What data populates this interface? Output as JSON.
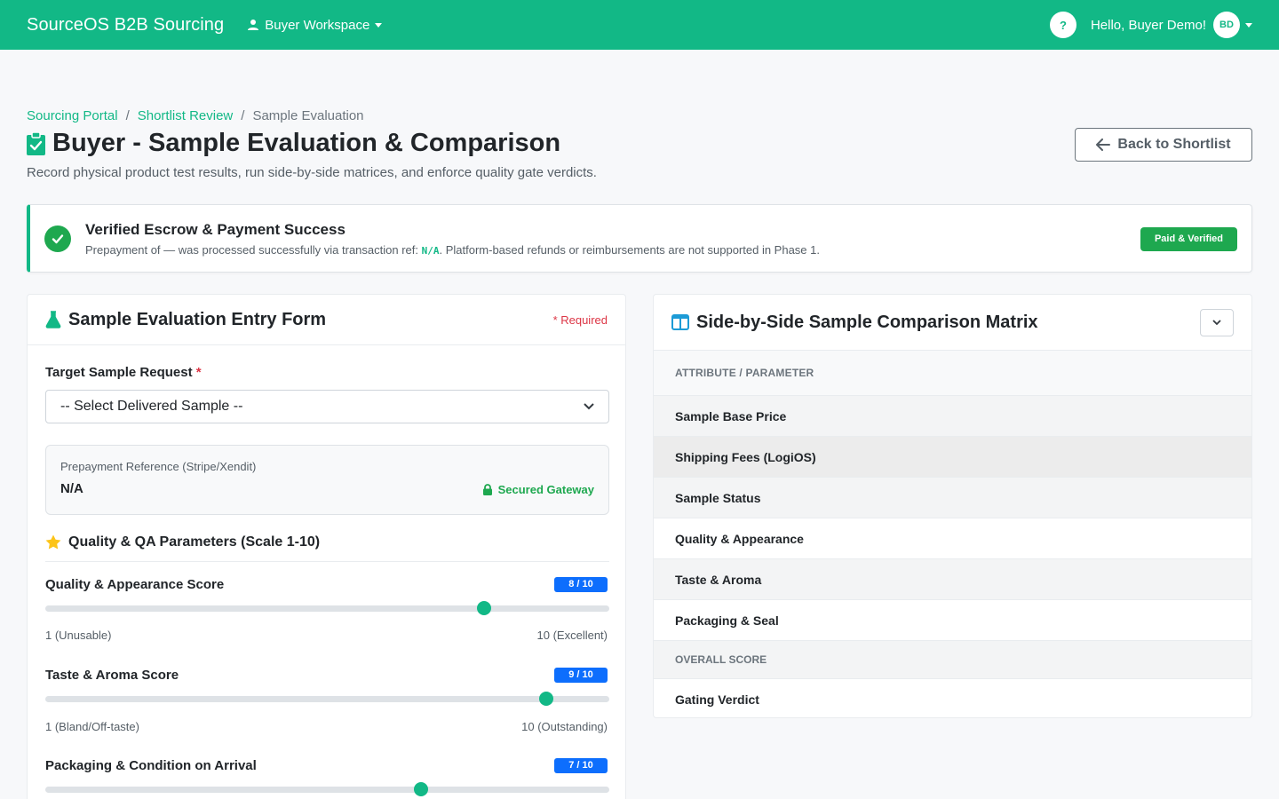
{
  "nav": {
    "brand": "SourceOS B2B Sourcing",
    "workspace": "Buyer Workspace",
    "help": "?",
    "greeting": "Hello, Buyer Demo!",
    "avatar": "BD",
    "accent": "#12b886"
  },
  "breadcrumb": {
    "items": [
      "Sourcing Portal",
      "Shortlist Review",
      "Sample Evaluation"
    ]
  },
  "page": {
    "title": "Buyer - Sample Evaluation & Comparison",
    "subtitle": "Record physical product test results, run side-by-side matrices, and enforce quality gate verdicts.",
    "back_label": "Back to Shortlist"
  },
  "alert": {
    "title": "Verified Escrow & Payment Success",
    "text_before": "Prepayment of — was processed successfully via transaction ref: ",
    "ref": "N/A",
    "text_after": ". Platform-based refunds or reimbursements are not supported in Phase 1.",
    "badge": "Paid & Verified"
  },
  "form": {
    "title": "Sample Evaluation Entry Form",
    "required_note": "* Required",
    "target_label": "Target Sample Request",
    "target_star": "*",
    "select_value": "-- Select Delivered Sample --",
    "prepay_label": "Prepayment Reference (Stripe/Xendit)",
    "prepay_value": "N/A",
    "secured": "Secured Gateway",
    "qa_title": "Quality & QA Parameters (Scale 1-10)",
    "scores": [
      {
        "label": "Quality & Appearance Score",
        "badge": "8 / 10",
        "value": 8,
        "min": "1 (Unusable)",
        "max": "10 (Excellent)"
      },
      {
        "label": "Taste & Aroma Score",
        "badge": "9 / 10",
        "value": 9,
        "min": "1 (Bland/Off-taste)",
        "max": "10 (Outstanding)"
      },
      {
        "label": "Packaging & Condition on Arrival",
        "badge": "7 / 10",
        "value": 7
      }
    ]
  },
  "matrix": {
    "title": "Side-by-Side Sample Comparison Matrix",
    "header": "ATTRIBUTE / PARAMETER",
    "rows": [
      "Sample Base Price",
      "Shipping Fees (LogiOS)",
      "Sample Status",
      "Quality & Appearance",
      "Taste & Aroma",
      "Packaging & Seal"
    ],
    "section": "OVERALL SCORE",
    "final_row": "Gating Verdict"
  }
}
